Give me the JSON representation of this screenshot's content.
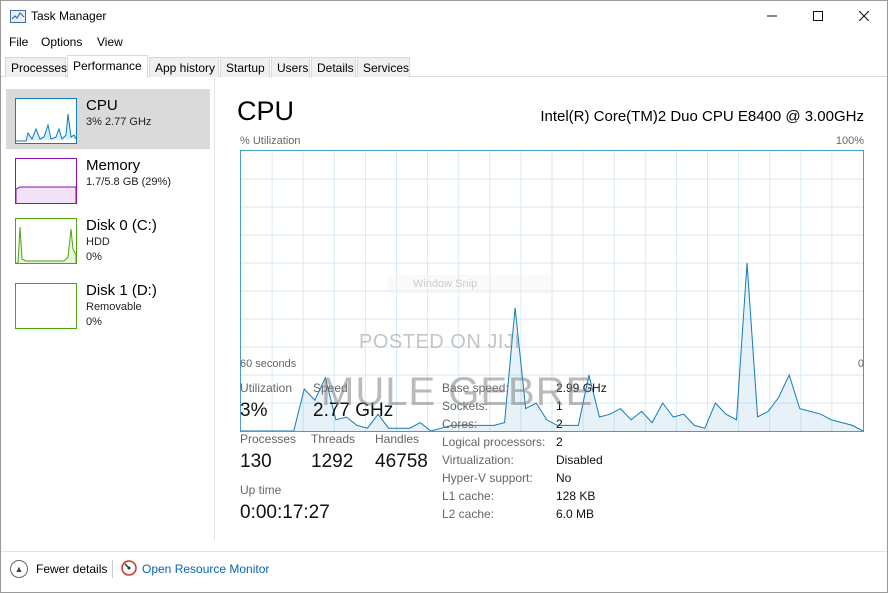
{
  "window": {
    "title": "Task Manager"
  },
  "menu": [
    "File",
    "Options",
    "View"
  ],
  "tabs": [
    "Processes",
    "Performance",
    "App history",
    "Startup",
    "Users",
    "Details",
    "Services"
  ],
  "active_tab": "Performance",
  "resources": [
    {
      "name": "CPU",
      "sub1": "3%  2.77 GHz",
      "sub2": "",
      "color": "#117dbb",
      "selected": true
    },
    {
      "name": "Memory",
      "sub1": "1.7/5.8 GB (29%)",
      "sub2": "",
      "color": "#8b12ae"
    },
    {
      "name": "Disk 0 (C:)",
      "sub1": "HDD",
      "sub2": "0%",
      "color": "#4da60c"
    },
    {
      "name": "Disk 1 (D:)",
      "sub1": "Removable",
      "sub2": "0%",
      "color": "#4da60c"
    }
  ],
  "cpu": {
    "title": "CPU",
    "model": "Intel(R) Core(TM)2 Duo CPU E8400 @ 3.00GHz",
    "util_label": "% Utilization",
    "util_max": "100%",
    "axis_left": "60 seconds",
    "axis_right": "0",
    "graph_color": "#117dbb",
    "history_percent": [
      0,
      0,
      0,
      0,
      0,
      0,
      15,
      11,
      19,
      4,
      5,
      2,
      1,
      6,
      1,
      1,
      1,
      3,
      0,
      1,
      2,
      2,
      2,
      2,
      2,
      3,
      44,
      8,
      10,
      4,
      2,
      2,
      2,
      20,
      5,
      6,
      8,
      4,
      7,
      3,
      10,
      5,
      6,
      2,
      1,
      10,
      6,
      4,
      60,
      5,
      7,
      12,
      20,
      8,
      7,
      6,
      4,
      3,
      2,
      0
    ]
  },
  "stats": {
    "utilization_label": "Utilization",
    "utilization": "3%",
    "speed_label": "Speed",
    "speed": "2.77 GHz",
    "processes_label": "Processes",
    "processes": "130",
    "threads_label": "Threads",
    "threads": "1292",
    "handles_label": "Handles",
    "handles": "46758",
    "uptime_label": "Up time",
    "uptime": "0:00:17:27"
  },
  "details": [
    {
      "label": "Base speed:",
      "value": "2.99 GHz"
    },
    {
      "label": "Sockets:",
      "value": "1"
    },
    {
      "label": "Cores:",
      "value": "2"
    },
    {
      "label": "Logical processors:",
      "value": "2"
    },
    {
      "label": "Virtualization:",
      "value": "Disabled"
    },
    {
      "label": "Hyper-V support:",
      "value": "No"
    },
    {
      "label": "L1 cache:",
      "value": "128 KB"
    },
    {
      "label": "L2 cache:",
      "value": "6.0 MB"
    }
  ],
  "watermark": {
    "snip": "Window Snip",
    "posted": "POSTED ON JIJI",
    "name": "MULE GEBRE"
  },
  "footer": {
    "fewer_details": "Fewer details",
    "open_monitor": "Open Resource Monitor"
  }
}
